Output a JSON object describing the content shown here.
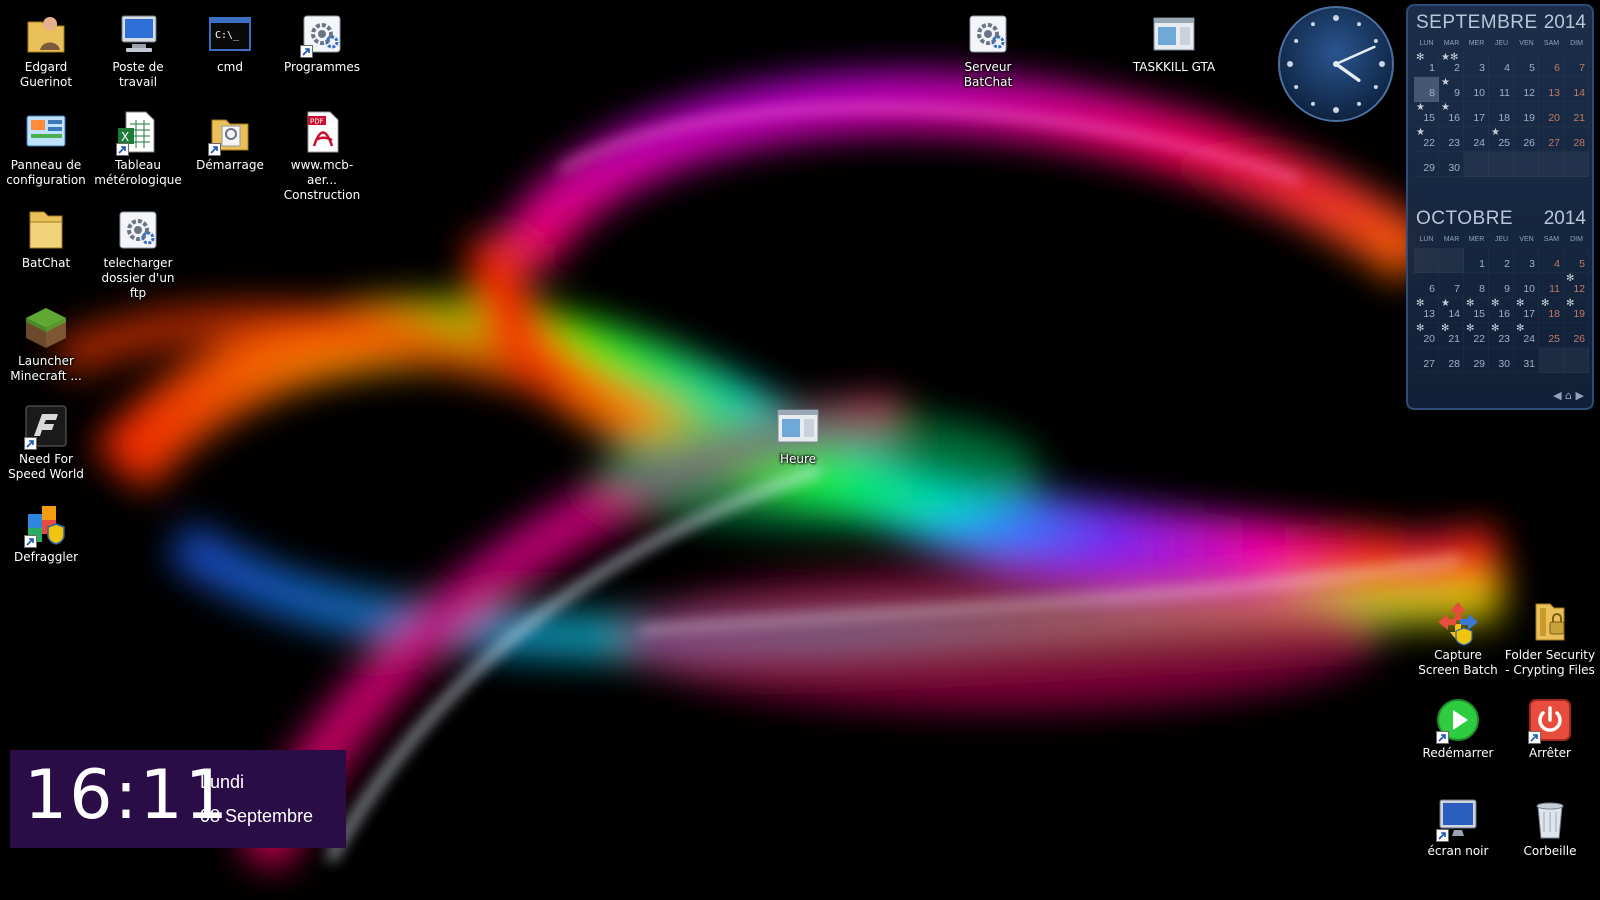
{
  "desktop": {
    "icons": [
      {
        "id": "edgard",
        "label": "Edgard Guerinot",
        "icon": "user-folder-icon"
      },
      {
        "id": "poste",
        "label": "Poste de travail",
        "icon": "computer-icon"
      },
      {
        "id": "cmd",
        "label": "cmd",
        "icon": "command-prompt-icon",
        "glyph_text": "C:\\_"
      },
      {
        "id": "programmes",
        "label": "Programmes",
        "icon": "gear-script-icon"
      },
      {
        "id": "panneau",
        "label": "Panneau de configuration",
        "icon": "control-panel-icon"
      },
      {
        "id": "tableau",
        "label": "Tableau métérologique",
        "icon": "excel-file-icon"
      },
      {
        "id": "demarrage",
        "label": "Démarrage",
        "icon": "folder-shortcut-icon"
      },
      {
        "id": "mcb",
        "label": "www.mcb-aer... Construction",
        "icon": "pdf-file-icon",
        "glyph_text": "PDF"
      },
      {
        "id": "batchat",
        "label": "BatChat",
        "icon": "folder-icon"
      },
      {
        "id": "telecharger",
        "label": "telecharger dossier d'un ftp",
        "icon": "gear-script-icon"
      },
      {
        "id": "minecraft",
        "label": "Launcher Minecraft ...",
        "icon": "minecraft-grass-block-icon"
      },
      {
        "id": "nfs",
        "label": "Need For Speed World",
        "icon": "need-for-speed-icon"
      },
      {
        "id": "defraggler",
        "label": "Defraggler",
        "icon": "defraggler-icon"
      },
      {
        "id": "serveur",
        "label": "Serveur BatChat",
        "icon": "gear-script-icon"
      },
      {
        "id": "taskkill",
        "label": "TASKKILL GTA",
        "icon": "window-app-icon"
      },
      {
        "id": "heure",
        "label": "Heure",
        "icon": "window-app-icon"
      },
      {
        "id": "capture",
        "label": "Capture Screen Batch",
        "icon": "capture-arrows-icon"
      },
      {
        "id": "folder_security",
        "label": "Folder Security - Crypting Files",
        "icon": "lock-folder-icon"
      },
      {
        "id": "redemarrer",
        "label": "Redémarrer",
        "icon": "restart-icon"
      },
      {
        "id": "arreter",
        "label": "Arrêter",
        "icon": "power-icon"
      },
      {
        "id": "ecran_noir",
        "label": "écran noir",
        "icon": "monitor-icon"
      },
      {
        "id": "corbeille",
        "label": "Corbeille",
        "icon": "recycle-bin-icon"
      }
    ]
  },
  "calendar": {
    "months": [
      {
        "name": "SEPTEMBRE",
        "year": "2014",
        "weekdays": [
          "LUN",
          "MAR",
          "MER",
          "JEU",
          "VEN",
          "SAM",
          "DIM"
        ],
        "leading_blanks": 0,
        "days": 30,
        "today": 8,
        "marks": {
          "1": "✻",
          "2": "★✻",
          "8": "",
          "9": "★",
          "15": "★",
          "16": "★",
          "22": "★",
          "25": "★"
        }
      },
      {
        "name": "OCTOBRE",
        "year": "2014",
        "weekdays": [
          "LUN",
          "MAR",
          "MER",
          "JEU",
          "VEN",
          "SAM",
          "DIM"
        ],
        "leading_blanks": 2,
        "days": 31,
        "marks": {
          "12": "✻",
          "14": "★",
          "13": "✻",
          "15": "✻",
          "16": "✻",
          "17": "✻",
          "18": "✻",
          "19": "✻",
          "20": "✻",
          "21": "✻",
          "22": "✻",
          "23": "✻",
          "24": "✻"
        }
      }
    ],
    "nav": "◀ ⌂ ▶"
  },
  "clock": {
    "hour": 16,
    "minute": 11
  },
  "time_widget": {
    "time": "16:11",
    "day": "Lundi",
    "date": "08 Septembre"
  },
  "colors": {
    "time_widget_bg": "#2a0d47",
    "calendar_bg": "#1c304e",
    "clock_face": "#1a3a66"
  }
}
